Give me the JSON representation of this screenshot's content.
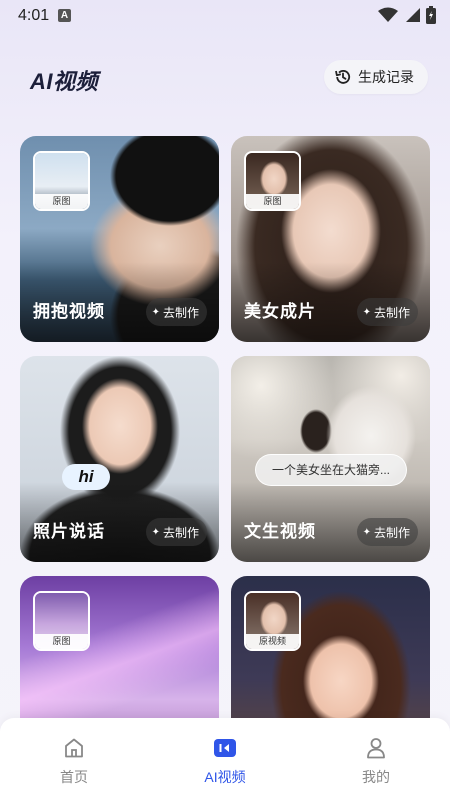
{
  "status": {
    "time": "4:01"
  },
  "header": {
    "title": "AI视频",
    "history_label": "生成记录"
  },
  "cards": [
    {
      "title": "拥抱视频",
      "button": "去制作",
      "thumb_label": "原图"
    },
    {
      "title": "美女成片",
      "button": "去制作",
      "thumb_label": "原图"
    },
    {
      "title": "照片说话",
      "button": "去制作",
      "bubble": "hi"
    },
    {
      "title": "文生视频",
      "button": "去制作",
      "prompt": "一个美女坐在大猫旁..."
    },
    {
      "thumb_label": "原图"
    },
    {
      "thumb_label": "原视频"
    }
  ],
  "nav": {
    "items": [
      {
        "label": "首页",
        "icon": "home-icon"
      },
      {
        "label": "AI视频",
        "icon": "video-icon"
      },
      {
        "label": "我的",
        "icon": "user-icon"
      }
    ],
    "active_color": "#2f55e8"
  }
}
